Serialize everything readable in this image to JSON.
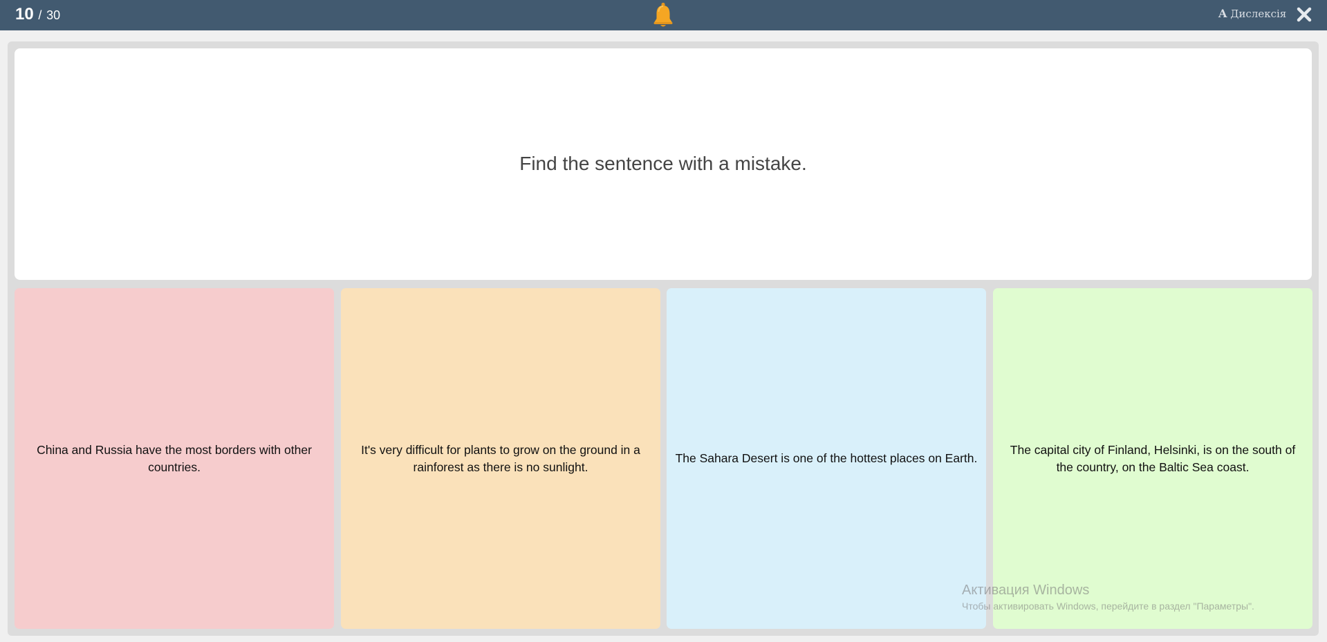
{
  "header": {
    "current": "10",
    "separator": "/",
    "total": "30",
    "bell_icon": "bell-icon",
    "dyslexia_icon_letter": "A",
    "dyslexia_label": "Дислексія",
    "close_icon": "close-icon",
    "bar_color": "#425a70",
    "bell_color": "#f5a623"
  },
  "question": {
    "text": "Find the sentence with a mistake."
  },
  "answers": [
    {
      "text": "China and Russia have the most borders with other countries.",
      "color": "#f6cccd"
    },
    {
      "text": "It's very difficult for plants to grow on the ground in a rainforest as there is no sunlight.",
      "color": "#fae1ba"
    },
    {
      "text": "The Sahara Desert is one of the hottest places on Earth.",
      "color": "#d9f0fa"
    },
    {
      "text": "The capital city of Finland, Helsinki, is on the south of the country, on the Baltic Sea coast.",
      "color": "#e0fcd0"
    }
  ],
  "watermark": {
    "title": "Активация Windows",
    "subtitle": "Чтобы активировать Windows, перейдите в раздел \"Параметры\"."
  }
}
